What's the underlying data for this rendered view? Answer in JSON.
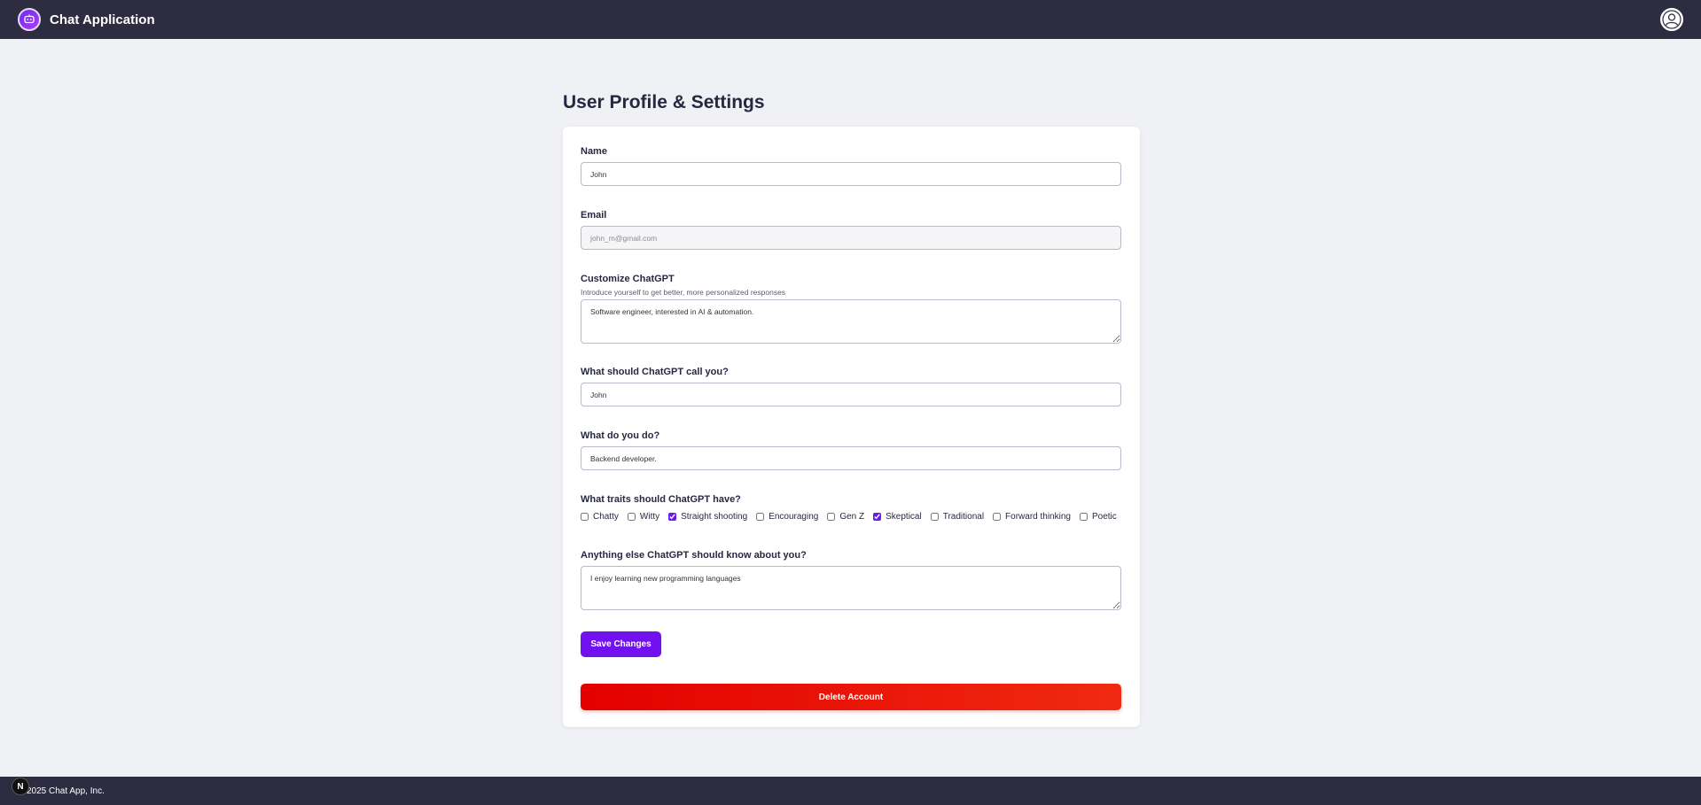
{
  "header": {
    "app_title": "Chat Application",
    "logo_icon": "chat-bot-icon",
    "profile_icon": "user-avatar-icon"
  },
  "page": {
    "title": "User Profile & Settings"
  },
  "form": {
    "name": {
      "label": "Name",
      "value": "John"
    },
    "email": {
      "label": "Email",
      "value": "john_m@gmail.com"
    },
    "customize": {
      "label": "Customize ChatGPT",
      "hint": "Introduce yourself to get better, more personalized responses",
      "value": "Software engineer, interested in AI & automation."
    },
    "call_you": {
      "label": "What should ChatGPT call you?",
      "value": "John"
    },
    "what_do": {
      "label": "What do you do?",
      "value": "Backend developer."
    },
    "traits": {
      "label": "What traits should ChatGPT have?",
      "items": [
        {
          "label": "Chatty",
          "checked": false
        },
        {
          "label": "Witty",
          "checked": false
        },
        {
          "label": "Straight shooting",
          "checked": true
        },
        {
          "label": "Encouraging",
          "checked": false
        },
        {
          "label": "Gen Z",
          "checked": false
        },
        {
          "label": "Skeptical",
          "checked": true
        },
        {
          "label": "Traditional",
          "checked": false
        },
        {
          "label": "Forward thinking",
          "checked": false
        },
        {
          "label": "Poetic",
          "checked": false
        }
      ]
    },
    "anything_else": {
      "label": "Anything else ChatGPT should know about you?",
      "value": "I enjoy learning new programming languages"
    },
    "save_label": "Save Changes",
    "delete_label": "Delete Account"
  },
  "footer": {
    "copyright": "2025 Chat App, Inc.",
    "badge": "N"
  },
  "colors": {
    "header_bg": "#2e2c40",
    "accent": "#7111ef",
    "danger": "#e30000",
    "page_bg": "#f0f1f5"
  }
}
